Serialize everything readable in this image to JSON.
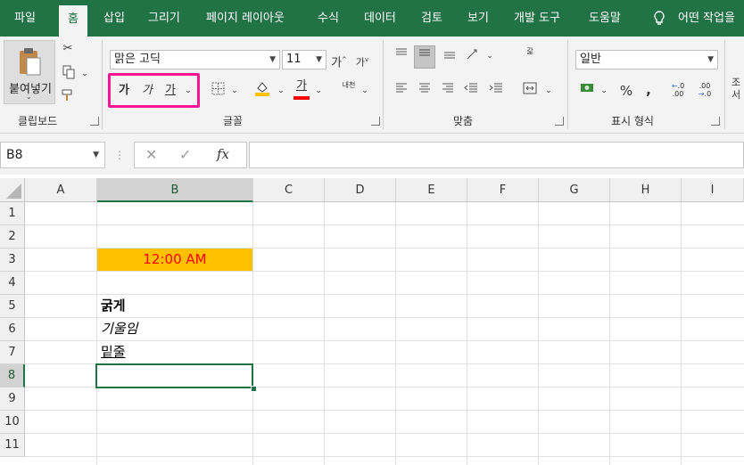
{
  "tabs": [
    "파일",
    "홈",
    "삽입",
    "그리기",
    "페이지 레이아웃",
    "수식",
    "데이터",
    "검토",
    "보기",
    "개발 도구",
    "도움말",
    "어떤 작업을"
  ],
  "clipboard": {
    "paste_label": "붙여넣기",
    "group_label": "클립보드"
  },
  "font": {
    "name": "맑은 고딕",
    "size": "11",
    "bold": "가",
    "italic": "가",
    "underline": "가",
    "grow": "가",
    "shrink": "가",
    "color_letter": "가",
    "phonetic": "내천",
    "group_label": "글꼴"
  },
  "alignment": {
    "group_label": "맞춤",
    "wrap": "갋"
  },
  "number": {
    "format": "일반",
    "percent": "%",
    "comma": ",",
    "inc": ".00",
    "dec": ".0",
    "group_label": "표시 형식"
  },
  "formula_bar": {
    "name_box": "B8",
    "cancel": "✕",
    "enter": "✓",
    "fx": "fx"
  },
  "columns": [
    "A",
    "B",
    "C",
    "D",
    "E",
    "F",
    "G",
    "H",
    "I"
  ],
  "rows": [
    "1",
    "2",
    "3",
    "4",
    "5",
    "6",
    "7",
    "8",
    "9",
    "10",
    "11"
  ],
  "cells": {
    "b3": "12:00 AM",
    "b5": "굵게",
    "b6": "기울임",
    "b7": "밑줄"
  },
  "colors": {
    "accent": "#217346",
    "highlight": "#ff1493",
    "fill_b3": "#ffc000",
    "text_b3": "#ff0000"
  }
}
